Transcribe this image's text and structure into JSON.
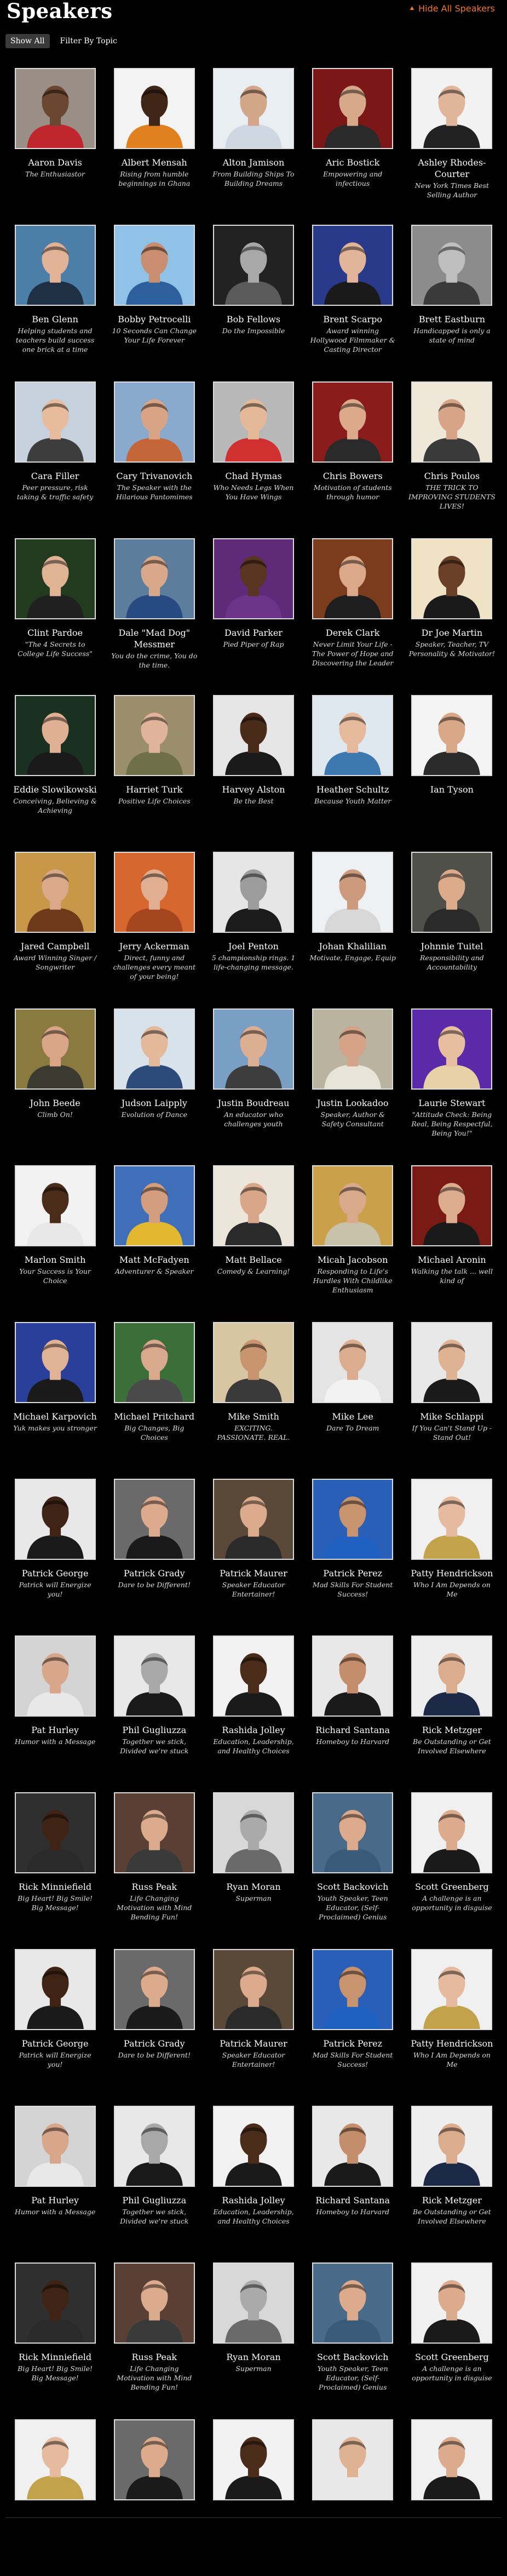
{
  "header": {
    "title": "Speakers",
    "hide_link": "Hide All Speakers",
    "hide_icon": "chevron-up-icon",
    "accent": "#f07828"
  },
  "filters": [
    {
      "label": "Show All",
      "active": true
    },
    {
      "label": "Filter By Topic",
      "active": false
    }
  ],
  "speakers": [
    {
      "name": "Aaron Davis",
      "tagline": "The Enthusiastor",
      "bg": "#9a8f86",
      "shirt": "#c0262e",
      "skin": "#6b4630"
    },
    {
      "name": "Albert Mensah",
      "tagline": "Rising from humble beginnings in Ghana",
      "bg": "#f3f3f3",
      "shirt": "#e0801e",
      "skin": "#3f2616"
    },
    {
      "name": "Alton Jamison",
      "tagline": "From Building Ships To Building Dreams",
      "bg": "#e8eef2",
      "shirt": "#cfd8e2",
      "skin": "#d3a68a"
    },
    {
      "name": "Aric Bostick",
      "tagline": "Empowering and infectious",
      "bg": "#7c1718",
      "shirt": "#2a2a2a",
      "skin": "#d7a88a"
    },
    {
      "name": "Ashley Rhodes-Courter",
      "tagline": "New York Times Best Selling Author",
      "bg": "#f2f2f2",
      "shirt": "#222222",
      "skin": "#e0b69a"
    },
    {
      "name": "Ben Glenn",
      "tagline": "Helping students and teachers build success one brick at a time",
      "bg": "#4b7fa8",
      "shirt": "#1f2f44",
      "skin": "#e2b296"
    },
    {
      "name": "Bobby Petrocelli",
      "tagline": "10 Seconds Can Change Your Life Forever",
      "bg": "#8fc2e6",
      "shirt": "#2d5f9d",
      "skin": "#c98d70"
    },
    {
      "name": "Bob Fellows",
      "tagline": "Do the Impossible",
      "bg": "#222222",
      "shirt": "#5a5a5a",
      "skin": "#a8a8a8"
    },
    {
      "name": "Brent Scarpo",
      "tagline": "Award winning Hollywood Filmmaker & Casting Director",
      "bg": "#2a3a8a",
      "shirt": "#1a1a1a",
      "skin": "#e2b59a"
    },
    {
      "name": "Brett Eastburn",
      "tagline": "Handicapped is only a state of mind",
      "bg": "#8c8c8c",
      "shirt": "#3a3a3a",
      "skin": "#bfbfbf"
    },
    {
      "name": "Cara Filler",
      "tagline": "Peer pressure, risk taking & traffic safety",
      "bg": "#c5d2de",
      "shirt": "#3d3d3d",
      "skin": "#e8bb9c"
    },
    {
      "name": "Cary Trivanovich",
      "tagline": "The Speaker with the Hilarious Pantomimes",
      "bg": "#89aacc",
      "shirt": "#c4663a",
      "skin": "#d9a385"
    },
    {
      "name": "Chad Hymas",
      "tagline": "Who Needs Legs When You Have Wings",
      "bg": "#b8b8b8",
      "shirt": "#d03030",
      "skin": "#e4b899"
    },
    {
      "name": "Chris Bowers",
      "tagline": "Motivation of students through humor",
      "bg": "#8a1c1c",
      "shirt": "#2a2a2a",
      "skin": "#dcaa8a"
    },
    {
      "name": "Chris Poulos",
      "tagline": "THE TRICK TO IMPROVING STUDENTS LIVES!",
      "bg": "#efe7d8",
      "shirt": "#3a3a3a",
      "skin": "#d7a488"
    },
    {
      "name": "Clint Pardoe",
      "tagline": "\"The 4 Secrets to College Life Success\"",
      "bg": "#223a1e",
      "shirt": "#202020",
      "skin": "#e0b395"
    },
    {
      "name": "Dale \"Mad Dog\" Messmer",
      "tagline": "You do the crime, You do the time.",
      "bg": "#5c7d9c",
      "shirt": "#284a82",
      "skin": "#d9a88b"
    },
    {
      "name": "David Parker",
      "tagline": "Pied Piper of Rap",
      "bg": "#5f2a78",
      "shirt": "#6c3488",
      "skin": "#5a3521"
    },
    {
      "name": "Derek Clark",
      "tagline": "Never Limit Your Life - The Power of Hope and Discovering the Leader",
      "bg": "#7a3c1c",
      "shirt": "#1e1e1e",
      "skin": "#dba98a"
    },
    {
      "name": "Dr Joe Martin",
      "tagline": "Speaker, Teacher, TV Personality & Motivator!",
      "bg": "#f0e2c4",
      "shirt": "#1a1a1a",
      "skin": "#6a4028"
    },
    {
      "name": "Eddie Slowikowski",
      "tagline": "Conceiving, Believing & Achieving",
      "bg": "#1a3020",
      "shirt": "#1a1a1a",
      "skin": "#dfb094"
    },
    {
      "name": "Harriet Turk",
      "tagline": "Positive Life Choices",
      "bg": "#9a8f6a",
      "shirt": "#6f6f4a",
      "skin": "#e0b49a"
    },
    {
      "name": "Harvey Alston",
      "tagline": "Be the Best",
      "bg": "#e6e6e6",
      "shirt": "#1a1a1a",
      "skin": "#4a2a18"
    },
    {
      "name": "Heather Schultz",
      "tagline": "Because Youth Matter",
      "bg": "#dfe8ee",
      "shirt": "#3d78b0",
      "skin": "#e6b99c"
    },
    {
      "name": "Ian Tyson",
      "tagline": "",
      "bg": "#f4f4f4",
      "shirt": "#2a2a2a",
      "skin": "#d8a889"
    },
    {
      "name": "Jared Campbell",
      "tagline": "Award Winning Singer / Songwriter",
      "bg": "#c89848",
      "shirt": "#6f3a1a",
      "skin": "#d9a98a"
    },
    {
      "name": "Jerry Ackerman",
      "tagline": "Direct, funny and challenges every meant of your being!",
      "bg": "#d6672e",
      "shirt": "#a64620",
      "skin": "#e0ae90"
    },
    {
      "name": "Joel Penton",
      "tagline": "5 championship rings. 1 life-changing message.",
      "bg": "#e6e6e6",
      "shirt": "#1c1c1c",
      "skin": "#9c9c9c"
    },
    {
      "name": "Johan Khalilian",
      "tagline": "Motivate, Engage, Equip",
      "bg": "#eef1f3",
      "shirt": "#d8d8d8",
      "skin": "#cc9a7c"
    },
    {
      "name": "Johnnie Tuitel",
      "tagline": "Responsibility and Accountability",
      "bg": "#50504a",
      "shirt": "#2a2a2a",
      "skin": "#dbab8c"
    },
    {
      "name": "John Beede",
      "tagline": "Climb On!",
      "bg": "#8a7a40",
      "shirt": "#3a3a30",
      "skin": "#d8a586"
    },
    {
      "name": "Judson Laipply",
      "tagline": "Evolution of Dance",
      "bg": "#d8e2ea",
      "shirt": "#2c4a7a",
      "skin": "#e3b89b"
    },
    {
      "name": "Justin Boudreau",
      "tagline": "An educator who challenges youth",
      "bg": "#7a9fc4",
      "shirt": "#3d3d3d",
      "skin": "#dcae92"
    },
    {
      "name": "Justin Lookadoo",
      "tagline": "Speaker, Author & Safety Consultant",
      "bg": "#b9b39f",
      "shirt": "#e8e4d8",
      "skin": "#d5a488"
    },
    {
      "name": "Laurie Stewart",
      "tagline": "\"Attitude Check: Being Real, Being Respectful, Being You!\"",
      "bg": "#5a2aa8",
      "shirt": "#e6d2a6",
      "skin": "#e8bea1"
    },
    {
      "name": "Marlon Smith",
      "tagline": "Your Success is Your Choice",
      "bg": "#f2f2f2",
      "shirt": "#e8e8e8",
      "skin": "#4b2c1a"
    },
    {
      "name": "Matt McFadyen",
      "tagline": "Adventurer & Speaker",
      "bg": "#3f6fb8",
      "shirt": "#e2b830",
      "skin": "#d39e7f"
    },
    {
      "name": "Matt Bellace",
      "tagline": "Comedy & Learning!",
      "bg": "#ece6da",
      "shirt": "#2a2a2a",
      "skin": "#d8a789"
    },
    {
      "name": "Micah Jacobson",
      "tagline": "Responding to Life's Hurdles With Childlike Enthusiasm",
      "bg": "#caa04a",
      "shirt": "#c8c2aa",
      "skin": "#d9a98c"
    },
    {
      "name": "Michael Aronin",
      "tagline": "Walking the talk ... well kind of",
      "bg": "#7a1a14",
      "shirt": "#1a1a1a",
      "skin": "#dcac8e"
    },
    {
      "name": "Michael Karpovich",
      "tagline": "Yuk makes you stronger",
      "bg": "#2a3f9a",
      "shirt": "#1a1a1a",
      "skin": "#e0b396"
    },
    {
      "name": "Michael Pritchard",
      "tagline": "Big Changes, Big Choices",
      "bg": "#3c6e3a",
      "shirt": "#4a4a4a",
      "skin": "#d8a98d"
    },
    {
      "name": "Mike Smith",
      "tagline": "EXCITING. PASSIONATE. REAL.",
      "bg": "#d8c6a2",
      "shirt": "#3a3a3a",
      "skin": "#c8946f"
    },
    {
      "name": "Mike Lee",
      "tagline": "Dare To Dream",
      "bg": "#e4e4e4",
      "shirt": "#f2f2f2",
      "skin": "#dcac8e"
    },
    {
      "name": "Mike Schlappi",
      "tagline": "If You Can't Stand Up - Stand Out!",
      "bg": "#e8e8e8",
      "shirt": "#1a1a1a",
      "skin": "#e0b294"
    },
    {
      "name": "Patrick George",
      "tagline": "Patrick will Energize you!",
      "bg": "#e8e8e8",
      "shirt": "#1a1a1a",
      "skin": "#3f2415"
    },
    {
      "name": "Patrick Grady",
      "tagline": "Dare to be Different!",
      "bg": "#6a6a6a",
      "shirt": "#1a1a1a",
      "skin": "#dcab8d"
    },
    {
      "name": "Patrick Maurer",
      "tagline": "Speaker Educator Entertainer!",
      "bg": "#5a4838",
      "shirt": "#2a2a2a",
      "skin": "#dcab8d"
    },
    {
      "name": "Patrick Perez",
      "tagline": "Mad Skills For Student Success!",
      "bg": "#2a5fb8",
      "shirt": "#2060c0",
      "skin": "#c8946f"
    },
    {
      "name": "Patty Hendrickson",
      "tagline": "Who I Am Depends on Me",
      "bg": "#f0f0f0",
      "shirt": "#c2a24a",
      "skin": "#e6ba9e"
    },
    {
      "name": "Pat Hurley",
      "tagline": "Humor with a Message",
      "bg": "#d4d4d4",
      "shirt": "#e8e8e8",
      "skin": "#d8a68a"
    },
    {
      "name": "Phil Gugliuzza",
      "tagline": "Together we stick, Divided we're stuck",
      "bg": "#e8e8e8",
      "shirt": "#1a1a1a",
      "skin": "#a8a8a8"
    },
    {
      "name": "Rashida Jolley",
      "tagline": "Education, Leadership, and Healthy Choices",
      "bg": "#f2f2f2",
      "shirt": "#1a1a1a",
      "skin": "#4b2c1a"
    },
    {
      "name": "Richard Santana",
      "tagline": "Homeboy to Harvard",
      "bg": "#e8e8e8",
      "shirt": "#1a1a1a",
      "skin": "#c48e6c"
    },
    {
      "name": "Rick Metzger",
      "tagline": "Be Outstanding or Get Involved Elsewhere",
      "bg": "#eeeeee",
      "shirt": "#1c2a48",
      "skin": "#dcac8e"
    },
    {
      "name": "Rick Minniefield",
      "tagline": "Big Heart! Big Smile! Big Message!",
      "bg": "#2f2f2f",
      "shirt": "#2a2a2a",
      "skin": "#3f2415"
    },
    {
      "name": "Russ Peak",
      "tagline": "Life Changing Motivation with Mind Bending Fun!",
      "bg": "#5a4034",
      "shirt": "#3a3a3a",
      "skin": "#dcab8d"
    },
    {
      "name": "Ryan Moran",
      "tagline": "Superman",
      "bg": "#d8d8d8",
      "shirt": "#6a6a6a",
      "skin": "#aaaaaa"
    },
    {
      "name": "Scott Backovich",
      "tagline": "Youth Speaker, Teen Educator, (Self-Proclaimed) Genius",
      "bg": "#4a6a8a",
      "shirt": "#3a5a7a",
      "skin": "#dcab8d"
    },
    {
      "name": "Scott Greenberg",
      "tagline": "A challenge is an opportunity in disguise",
      "bg": "#f0f0f0",
      "shirt": "#1a1a1a",
      "skin": "#dcab8d"
    },
    {
      "name": "Patrick George",
      "tagline": "Patrick will Energize you!",
      "bg": "#e8e8e8",
      "shirt": "#1a1a1a",
      "skin": "#3f2415"
    },
    {
      "name": "Patrick Grady",
      "tagline": "Dare to be Different!",
      "bg": "#6a6a6a",
      "shirt": "#1a1a1a",
      "skin": "#dcab8d"
    },
    {
      "name": "Patrick Maurer",
      "tagline": "Speaker Educator Entertainer!",
      "bg": "#5a4838",
      "shirt": "#2a2a2a",
      "skin": "#dcab8d"
    },
    {
      "name": "Patrick Perez",
      "tagline": "Mad Skills For Student Success!",
      "bg": "#2a5fb8",
      "shirt": "#2060c0",
      "skin": "#c8946f"
    },
    {
      "name": "Patty Hendrickson",
      "tagline": "Who I Am Depends on Me",
      "bg": "#f0f0f0",
      "shirt": "#c2a24a",
      "skin": "#e6ba9e"
    },
    {
      "name": "Pat Hurley",
      "tagline": "Humor with a Message",
      "bg": "#d4d4d4",
      "shirt": "#e8e8e8",
      "skin": "#d8a68a"
    },
    {
      "name": "Phil Gugliuzza",
      "tagline": "Together we stick, Divided we're stuck",
      "bg": "#e8e8e8",
      "shirt": "#1a1a1a",
      "skin": "#a8a8a8"
    },
    {
      "name": "Rashida Jolley",
      "tagline": "Education, Leadership, and Healthy Choices",
      "bg": "#f2f2f2",
      "shirt": "#1a1a1a",
      "skin": "#4b2c1a"
    },
    {
      "name": "Richard Santana",
      "tagline": "Homeboy to Harvard",
      "bg": "#e8e8e8",
      "shirt": "#1a1a1a",
      "skin": "#c48e6c"
    },
    {
      "name": "Rick Metzger",
      "tagline": "Be Outstanding or Get Involved Elsewhere",
      "bg": "#eeeeee",
      "shirt": "#1c2a48",
      "skin": "#dcac8e"
    },
    {
      "name": "Rick Minniefield",
      "tagline": "Big Heart! Big Smile! Big Message!",
      "bg": "#2f2f2f",
      "shirt": "#2a2a2a",
      "skin": "#3f2415"
    },
    {
      "name": "Russ Peak",
      "tagline": "Life Changing Motivation with Mind Bending Fun!",
      "bg": "#5a4034",
      "shirt": "#3a3a3a",
      "skin": "#dcab8d"
    },
    {
      "name": "Ryan Moran",
      "tagline": "Superman",
      "bg": "#d8d8d8",
      "shirt": "#6a6a6a",
      "skin": "#aaaaaa"
    },
    {
      "name": "Scott Backovich",
      "tagline": "Youth Speaker, Teen Educator, (Self-Proclaimed) Genius",
      "bg": "#4a6a8a",
      "shirt": "#3a5a7a",
      "skin": "#dcab8d"
    },
    {
      "name": "Scott Greenberg",
      "tagline": "A challenge is an opportunity in disguise",
      "bg": "#f0f0f0",
      "shirt": "#1a1a1a",
      "skin": "#dcab8d"
    },
    {
      "name": "",
      "tagline": "",
      "bg": "#f0f0f0",
      "shirt": "#c2a24a",
      "skin": "#e6ba9e"
    },
    {
      "name": "",
      "tagline": "",
      "bg": "#6a6a6a",
      "shirt": "#1a1a1a",
      "skin": "#dcab8d"
    },
    {
      "name": "",
      "tagline": "",
      "bg": "#f2f2f2",
      "shirt": "#1a1a1a",
      "skin": "#4b2c1a"
    },
    {
      "name": "",
      "tagline": "",
      "bg": "#e8e8e8",
      "shirt": "#e8e8e8",
      "skin": "#e0b294"
    },
    {
      "name": "",
      "tagline": "",
      "bg": "#f0f0f0",
      "shirt": "#1a1a1a",
      "skin": "#dcab8d"
    }
  ]
}
